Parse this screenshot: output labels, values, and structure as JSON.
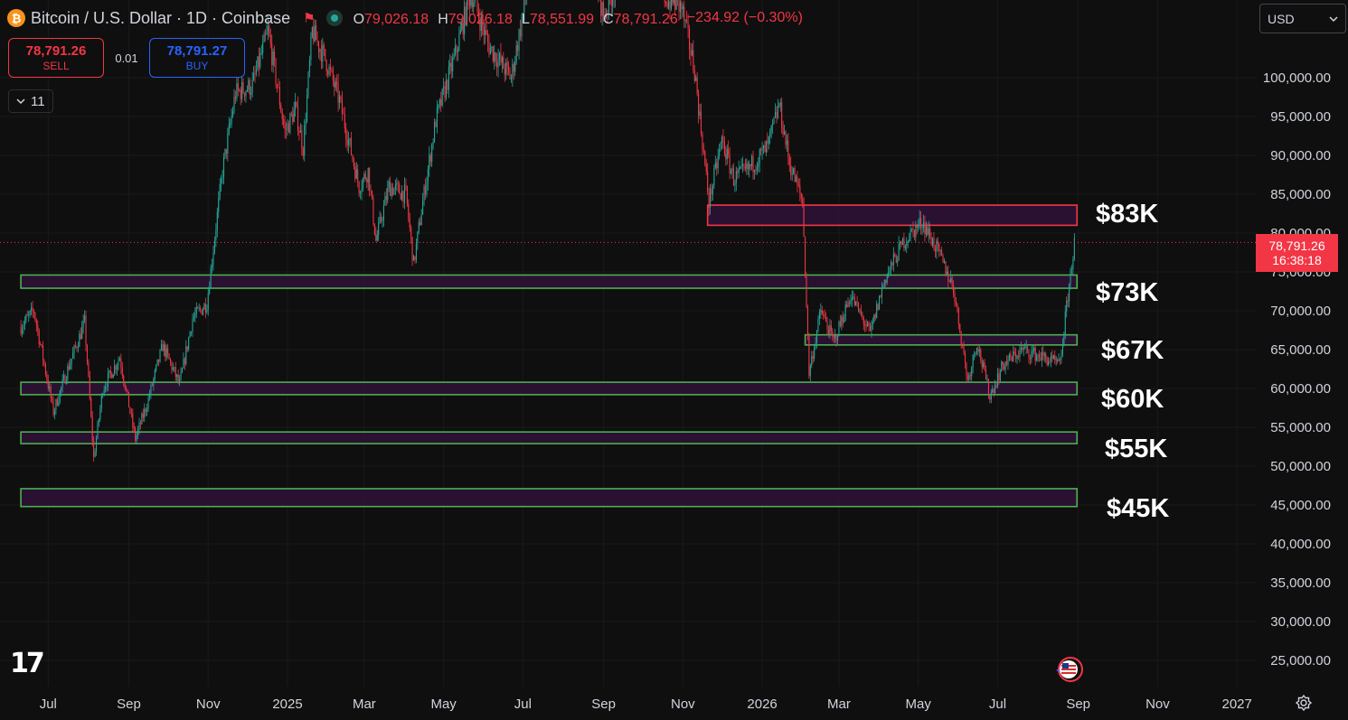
{
  "header": {
    "symbol_title": "Bitcoin / U.S. Dollar · 1D · Coinbase",
    "open_label": "O",
    "open_value": "79,026.18",
    "high_label": "H",
    "high_value": "79,026.18",
    "low_label": "L",
    "low_value": "78,551.99",
    "close_label": "C",
    "close_value": "78,791.26",
    "change_value": "−234.92 (−0.30%)"
  },
  "trade": {
    "sell_price": "78,791.26",
    "sell_label": "SELL",
    "spread": "0.01",
    "buy_price": "78,791.27",
    "buy_label": "BUY"
  },
  "indicators_toggle": {
    "count": "11",
    "icon": "chevron-down-icon"
  },
  "currency": {
    "selected": "USD",
    "icon": "chevron-down-icon"
  },
  "price_tag": {
    "price": "78,791.26",
    "countdown": "16:38:18"
  },
  "colors": {
    "background": "#0f0f0f",
    "up": "#26a69a",
    "down": "#f23645",
    "zone_fill": "#2d1236",
    "support_border": "#4caf50",
    "resistance_border": "#f23645",
    "axis_text": "#d1d4dc"
  },
  "chart_data": {
    "type": "candlestick",
    "title": "",
    "xlabel": "",
    "ylabel": "",
    "ylim": [
      21000,
      120000
    ],
    "grid": true,
    "y_ticks": [
      {
        "value": 100000,
        "label": "100,000.00"
      },
      {
        "value": 95000,
        "label": "95,000.00"
      },
      {
        "value": 90000,
        "label": "90,000.00"
      },
      {
        "value": 85000,
        "label": "85,000.00"
      },
      {
        "value": 80000,
        "label": "80,000.00"
      },
      {
        "value": 75000,
        "label": "75,000.00"
      },
      {
        "value": 70000,
        "label": "70,000.00"
      },
      {
        "value": 65000,
        "label": "65,000.00"
      },
      {
        "value": 60000,
        "label": "60,000.00"
      },
      {
        "value": 55000,
        "label": "55,000.00"
      },
      {
        "value": 50000,
        "label": "50,000.00"
      },
      {
        "value": 45000,
        "label": "45,000.00"
      },
      {
        "value": 40000,
        "label": "40,000.00"
      },
      {
        "value": 35000,
        "label": "35,000.00"
      },
      {
        "value": 30000,
        "label": "30,000.00"
      },
      {
        "value": 25000,
        "label": "25,000.00"
      }
    ],
    "x_ticks": [
      {
        "date": "2024-07-01",
        "label": "Jul"
      },
      {
        "date": "2024-09-01",
        "label": "Sep"
      },
      {
        "date": "2024-11-01",
        "label": "Nov"
      },
      {
        "date": "2025-01-01",
        "label": "2025"
      },
      {
        "date": "2025-03-01",
        "label": "Mar"
      },
      {
        "date": "2025-05-01",
        "label": "May"
      },
      {
        "date": "2025-07-01",
        "label": "Jul"
      },
      {
        "date": "2025-09-01",
        "label": "Sep"
      },
      {
        "date": "2025-11-01",
        "label": "Nov"
      },
      {
        "date": "2026-01-01",
        "label": "2026"
      },
      {
        "date": "2026-03-01",
        "label": "Mar"
      },
      {
        "date": "2026-05-01",
        "label": "May"
      },
      {
        "date": "2026-07-01",
        "label": "Jul"
      },
      {
        "date": "2026-09-01",
        "label": "Sep"
      },
      {
        "date": "2026-11-01",
        "label": "Nov"
      },
      {
        "date": "2027-01-01",
        "label": "2027"
      }
    ],
    "price_path": [
      [
        "2024-06-10",
        68000
      ],
      [
        "2024-06-20",
        70000
      ],
      [
        "2024-07-05",
        57000
      ],
      [
        "2024-07-15",
        62000
      ],
      [
        "2024-07-29",
        68500
      ],
      [
        "2024-08-05",
        51000
      ],
      [
        "2024-08-12",
        60000
      ],
      [
        "2024-08-25",
        64000
      ],
      [
        "2024-09-06",
        53500
      ],
      [
        "2024-09-15",
        58000
      ],
      [
        "2024-09-27",
        65500
      ],
      [
        "2024-10-10",
        60500
      ],
      [
        "2024-10-20",
        69000
      ],
      [
        "2024-10-31",
        71000
      ],
      [
        "2024-11-12",
        88000
      ],
      [
        "2024-11-22",
        98000
      ],
      [
        "2024-12-05",
        99000
      ],
      [
        "2024-12-17",
        106000
      ],
      [
        "2024-12-30",
        93000
      ],
      [
        "2025-01-07",
        96000
      ],
      [
        "2025-01-13",
        91000
      ],
      [
        "2025-01-20",
        106000
      ],
      [
        "2025-01-31",
        102000
      ],
      [
        "2025-02-10",
        97000
      ],
      [
        "2025-02-25",
        86000
      ],
      [
        "2025-03-04",
        88000
      ],
      [
        "2025-03-10",
        79000
      ],
      [
        "2025-03-20",
        86000
      ],
      [
        "2025-04-02",
        85000
      ],
      [
        "2025-04-08",
        76000
      ],
      [
        "2025-04-15",
        84000
      ],
      [
        "2025-04-25",
        94500
      ],
      [
        "2025-05-10",
        103000
      ],
      [
        "2025-05-22",
        111000
      ],
      [
        "2025-06-05",
        104000
      ],
      [
        "2025-06-22",
        100000
      ],
      [
        "2025-07-14",
        120000
      ],
      [
        "2025-08-14",
        121000
      ],
      [
        "2025-09-01",
        108000
      ],
      [
        "2025-09-20",
        116000
      ],
      [
        "2025-10-06",
        124000
      ],
      [
        "2025-10-10",
        112000
      ],
      [
        "2025-10-20",
        110000
      ],
      [
        "2025-10-31",
        109000
      ],
      [
        "2025-11-10",
        101000
      ],
      [
        "2025-11-21",
        84000
      ],
      [
        "2025-12-01",
        92000
      ],
      [
        "2025-12-10",
        87000
      ],
      [
        "2025-12-20",
        88000
      ],
      [
        "2026-01-05",
        91000
      ],
      [
        "2026-01-14",
        96500
      ],
      [
        "2026-01-22",
        89000
      ],
      [
        "2026-02-01",
        84000
      ],
      [
        "2026-02-06",
        62000
      ],
      [
        "2026-02-15",
        70000
      ],
      [
        "2026-02-25",
        66000
      ],
      [
        "2026-03-10",
        72000
      ],
      [
        "2026-03-25",
        67000
      ],
      [
        "2026-04-05",
        74000
      ],
      [
        "2026-04-20",
        79000
      ],
      [
        "2026-05-04",
        81500
      ],
      [
        "2026-05-15",
        78000
      ],
      [
        "2026-05-28",
        73000
      ],
      [
        "2026-06-08",
        61000
      ],
      [
        "2026-06-15",
        66000
      ],
      [
        "2026-06-25",
        59000
      ],
      [
        "2026-07-05",
        63000
      ],
      [
        "2026-07-20",
        65000
      ],
      [
        "2026-08-05",
        64000
      ],
      [
        "2026-08-18",
        63000
      ],
      [
        "2026-08-24",
        72000
      ],
      [
        "2026-08-29",
        78791
      ]
    ],
    "zones": [
      {
        "label": "$83K",
        "kind": "resistance",
        "low": 81000,
        "high": 83600,
        "start": "2025-11-20",
        "end": "2026-08-31"
      },
      {
        "label": "$73K",
        "kind": "support",
        "low": 72900,
        "high": 74600,
        "start": "2024-06-10",
        "end": "2026-08-31"
      },
      {
        "label": "$67K",
        "kind": "support",
        "low": 65600,
        "high": 66900,
        "start": "2026-02-03",
        "end": "2026-08-31"
      },
      {
        "label": "$60K",
        "kind": "support",
        "low": 59200,
        "high": 60800,
        "start": "2024-06-10",
        "end": "2026-08-31"
      },
      {
        "label": "$55K",
        "kind": "support",
        "low": 52900,
        "high": 54400,
        "start": "2024-06-10",
        "end": "2026-08-31"
      },
      {
        "label": "$45K",
        "kind": "support",
        "low": 44800,
        "high": 47100,
        "start": "2024-06-10",
        "end": "2026-08-31"
      }
    ],
    "last_price": 78791.26
  }
}
